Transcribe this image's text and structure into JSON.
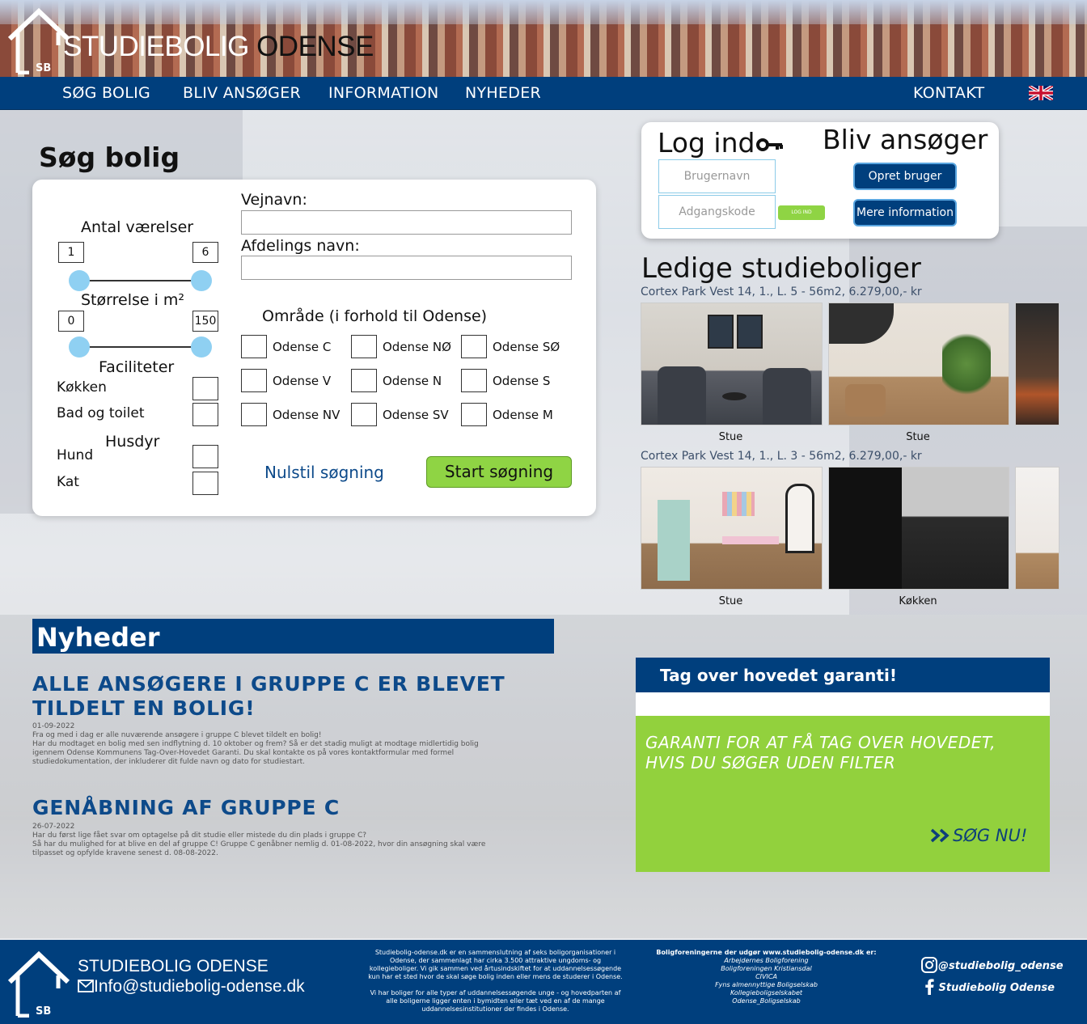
{
  "header": {
    "title_part1": "STUDIEBOLIG",
    "title_part2": "ODENSE",
    "logo_text": "SB"
  },
  "nav": {
    "items": [
      "SØG BOLIG",
      "BLIV ANSØGER",
      "INFORMATION",
      "NYHEDER"
    ],
    "contact": "KONTAKT",
    "language_icon": "uk-flag-icon"
  },
  "search": {
    "title": "Søg bolig",
    "rooms_label": "Antal værelser",
    "rooms_min": "1",
    "rooms_max": "6",
    "size_label": "Størrelse i m²",
    "size_min": "0",
    "size_max": "150",
    "facilities_label": "Faciliteter",
    "facility_kitchen": "Køkken",
    "facility_bath": "Bad og toilet",
    "pets_label": "Husdyr",
    "pet_dog": "Hund",
    "pet_cat": "Kat",
    "street_label": "Vejnavn:",
    "department_label": "Afdelings navn:",
    "area_label": "Område (i forhold til Odense)",
    "areas": [
      "Odense C",
      "Odense NØ",
      "Odense SØ",
      "Odense V",
      "Odense N",
      "Odense S",
      "Odense NV",
      "Odense SV",
      "Odense M"
    ],
    "reset": "Nulstil søgning",
    "start": "Start søgning"
  },
  "login": {
    "title": "Log ind",
    "username_placeholder": "Brugernavn",
    "password_placeholder": "Adgangskode",
    "login_button": "LOG IND",
    "apply_title": "Bliv ansøger",
    "create_user": "Opret bruger",
    "more_info": "Mere information"
  },
  "listings": {
    "title": "Ledige studieboliger",
    "items": [
      {
        "address": "Cortex Park Vest 14, 1., L. 5 - 56m2, 6.279,00,- kr",
        "captions": [
          "Stue",
          "Stue"
        ]
      },
      {
        "address": "Cortex Park Vest 14, 1., L. 3 - 56m2, 6.279,00,- kr",
        "captions": [
          "Stue",
          "Køkken"
        ]
      }
    ]
  },
  "news": {
    "title": "Nyheder",
    "items": [
      {
        "headline_line1": "ALLE ANSØGERE I GRUPPE C ER BLEVET",
        "headline_line2": "TILDELT EN BOLIG!",
        "date": "01-09-2022",
        "body": [
          "Fra og med i dag er alle nuværende ansøgere i gruppe C blevet tildelt en bolig!",
          "Har du modtaget en bolig med sen indflytning d. 10 oktober og frem? Så er det stadig muligt at modtage midlertidig bolig",
          "igennem Odense Kommunens Tag-Over-Hovedet Garanti. Du skal kontakte os på vores kontaktformular med formel",
          "studiedokumentation, der inkluderer dit fulde navn og dato for studiestart."
        ]
      },
      {
        "headline_line1": "GENÅBNING AF GRUPPE C",
        "date": "26-07-2022",
        "body": [
          "Har du først lige fået svar om optagelse på dit studie eller mistede du din plads i gruppe C?",
          "Så har du mulighed for at blive en del af gruppe C! Gruppe C genåbner nemlig d. 01-08-2022, hvor din ansøgning skal være",
          "tilpasset og opfylde kravene senest d. 08-08-2022."
        ]
      }
    ]
  },
  "guarantee": {
    "title": "Tag over hovedet garanti!",
    "text_line1": "GARANTI FOR AT FÅ TAG OVER HOVEDET,",
    "text_line2": "HVIS DU SØGER UDEN FILTER",
    "cta": "SØG NU!"
  },
  "footer": {
    "brand": "STUDIEBOLIG ODENSE",
    "email": "Info@studiebolig-odense.dk",
    "about": [
      "Studiebolig-odense.dk er en sammenslutning af seks boligorganisationer i",
      "Odense, der sammenlagt har cirka 3.500 attraktive ungdoms- og",
      "kollegieboliger. Vi gik sammen ved årtusindskiftet for at uddannelsessøgende",
      "kun har et sted hvor de skal søge bolig inden eller mens de studerer i Odense.",
      "",
      "Vi har boliger for alle typer af uddannelsessøgende unge - og hovedparten af",
      "alle boligerne ligger enten i bymidten eller tæt ved en af de mange",
      "uddannelsesinstitutioner der findes i Odense."
    ],
    "orgs_title": "Boligforeningerne der udgør www.studiebolig-odense.dk er:",
    "orgs": [
      "Arbejdernes Boligforening",
      "Boligforeningen Kristiansdal",
      "CIVICA",
      "Fyns almennyttige Boligselskab",
      "Kollegieboligselskabet",
      "Odense_Boligselskab"
    ],
    "instagram": "@studiebolig_odense",
    "facebook": "Studiebolig Odense"
  },
  "colors": {
    "primary": "#003f7d",
    "accent_green": "#92d13d",
    "button_green": "#8fd444",
    "slider_knob": "#8fd0f2",
    "link_blue": "#0d4a8a"
  }
}
